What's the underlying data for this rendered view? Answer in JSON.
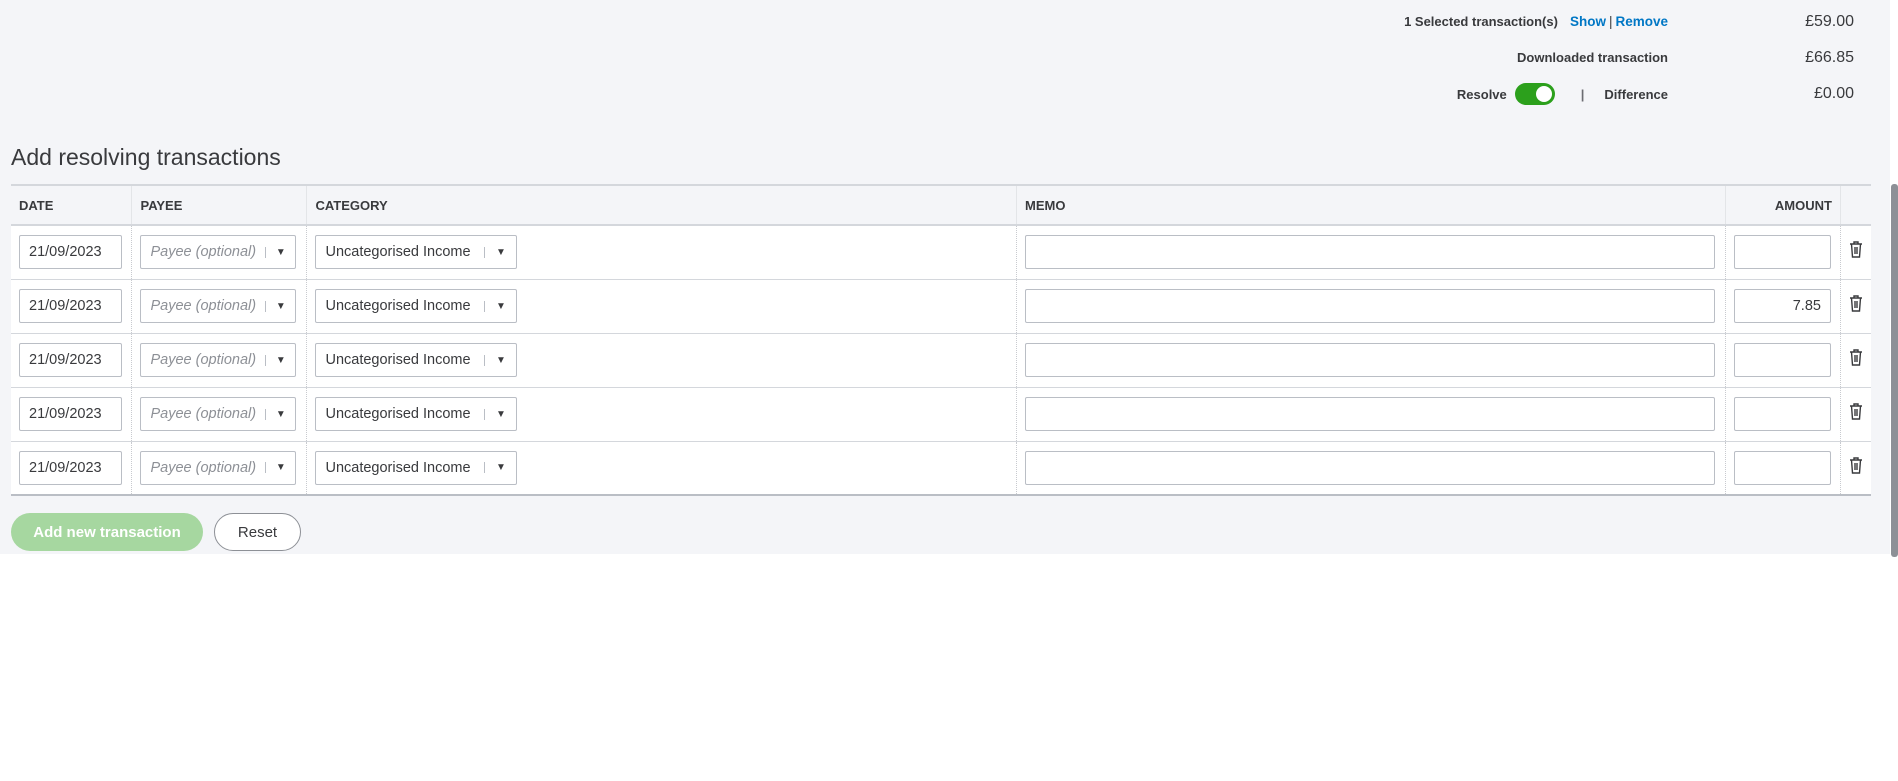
{
  "summary": {
    "selected_label": "1 Selected transaction(s)",
    "show_link": "Show",
    "divider": "|",
    "remove_link": "Remove",
    "selected_amount": "£59.00",
    "downloaded_label": "Downloaded transaction",
    "downloaded_amount": "£66.85",
    "resolve_label": "Resolve",
    "resolve_on": true,
    "difference_label": "Difference",
    "difference_amount": "£0.00"
  },
  "section_title": "Add resolving transactions",
  "table": {
    "headers": {
      "date": "DATE",
      "payee": "PAYEE",
      "category": "CATEGORY",
      "memo": "MEMO",
      "amount": "AMOUNT"
    },
    "payee_placeholder": "Payee (optional)",
    "rows": [
      {
        "date": "21/09/2023",
        "category": "Uncategorised Income",
        "memo": "",
        "amount": ""
      },
      {
        "date": "21/09/2023",
        "category": "Uncategorised Income",
        "memo": "",
        "amount": "7.85"
      },
      {
        "date": "21/09/2023",
        "category": "Uncategorised Income",
        "memo": "",
        "amount": ""
      },
      {
        "date": "21/09/2023",
        "category": "Uncategorised Income",
        "memo": "",
        "amount": ""
      },
      {
        "date": "21/09/2023",
        "category": "Uncategorised Income",
        "memo": "",
        "amount": ""
      }
    ]
  },
  "buttons": {
    "add_new": "Add new transaction",
    "reset": "Reset"
  },
  "colors": {
    "accent_green": "#2ca01c",
    "link_blue": "#0077c5",
    "disabled_green": "#a6d7a0"
  }
}
